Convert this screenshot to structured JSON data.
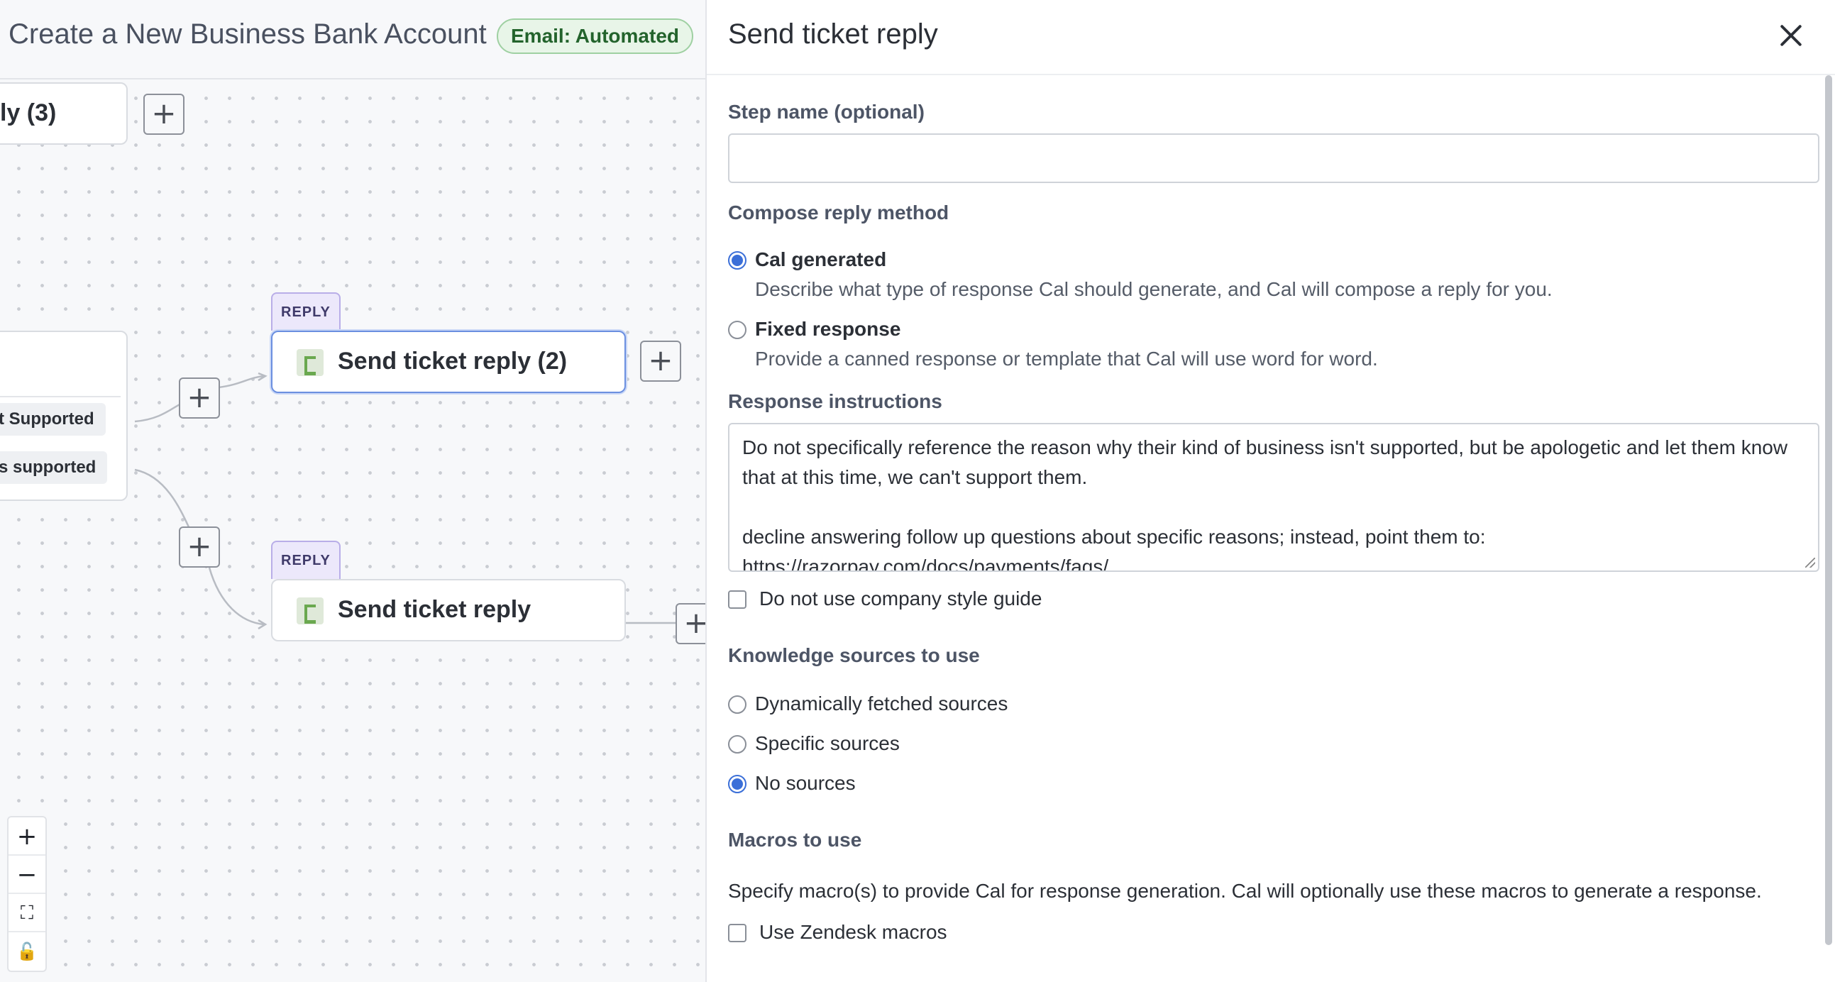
{
  "workflow": {
    "title": "Create a New Business Bank Account",
    "badge": "Email: Automated"
  },
  "canvas": {
    "node_top_partial": "ly (3)",
    "node_reply_tag": "REPLY",
    "node_reply_2_title": "Send ticket reply (2)",
    "node_reply_title": "Send ticket reply",
    "branch_chip_1": "t Supported",
    "branch_chip_2": "s supported",
    "plus_symbol": "+",
    "zoom": {
      "in": "+",
      "out": "−",
      "fit": "⛶",
      "lock": "🔓"
    }
  },
  "panel": {
    "title": "Send ticket reply",
    "step_name": {
      "label": "Step name (optional)",
      "value": "",
      "placeholder": ""
    },
    "compose": {
      "label": "Compose reply method",
      "options": [
        {
          "label": "Cal generated",
          "description": "Describe what type of response Cal should generate, and Cal will compose a reply for you.",
          "checked": true
        },
        {
          "label": "Fixed response",
          "description": "Provide a canned response or template that Cal will use word for word.",
          "checked": false
        }
      ]
    },
    "response_instructions": {
      "label": "Response instructions",
      "lines": [
        "Do not specifically reference the reason why their kind of business isn't supported, but be apologetic and let them know",
        "that at this time, we can't support them.",
        "",
        "decline answering follow up questions about specific reasons; instead, point them to:",
        "https://razorpay.com/docs/payments/faqs/"
      ]
    },
    "style_guide_checkbox": "Do not use company style guide",
    "knowledge": {
      "label": "Knowledge sources to use",
      "options": [
        {
          "label": "Dynamically fetched sources",
          "checked": false
        },
        {
          "label": "Specific sources",
          "checked": false
        },
        {
          "label": "No sources",
          "checked": true
        }
      ]
    },
    "macros": {
      "label": "Macros to use",
      "description": "Specify macro(s) to provide Cal for response generation. Cal will optionally use these macros to generate a response.",
      "checkbox": "Use Zendesk macros"
    }
  },
  "colors": {
    "accent": "#3b6fd8",
    "badge_green": "#23632c",
    "reply_tag": "#ece8fb"
  }
}
